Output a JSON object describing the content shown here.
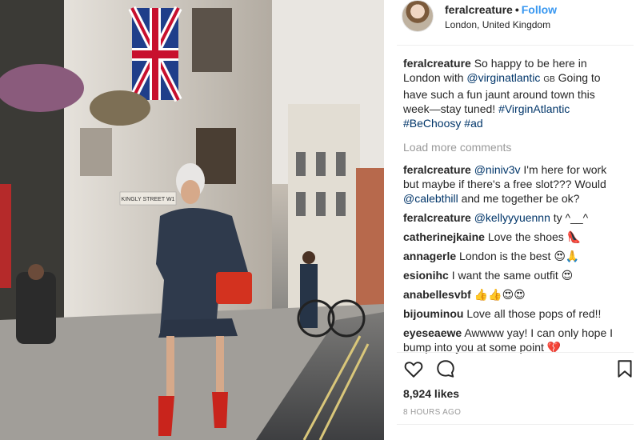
{
  "header": {
    "username": "feralcreature",
    "dot": "•",
    "follow_label": "Follow",
    "location": "London, United Kingdom"
  },
  "caption": {
    "username": "feralcreature",
    "text_1": "So happy to be here in London with",
    "mention": "@virginatlantic",
    "flag": "GB",
    "text_2": "Going to have such a fun jaunt around town this week—stay tuned!",
    "hashtag_1": "#VirginAtlantic",
    "hashtag_2": "#BeChoosy",
    "hashtag_3": "#ad"
  },
  "load_more_label": "Load more comments",
  "comments": [
    {
      "user": "feralcreature",
      "mention": "@niniv3v",
      "text": "I'm here for work but maybe if there's a free slot??? Would",
      "mention2": "@calebthill",
      "text2": "and me together be ok?"
    },
    {
      "user": "feralcreature",
      "mention": "@kellyyyuennn",
      "text": "ty ^__^"
    },
    {
      "user": "catherinejkaine",
      "text": "Love the shoes 👠"
    },
    {
      "user": "annagerle",
      "text": "London is the best 😍🙏"
    },
    {
      "user": "esionihc",
      "text": "I want the same outfit 😍"
    },
    {
      "user": "anabellesvbf",
      "text": "👍👍😍😍"
    },
    {
      "user": "bijouminou",
      "text": "Love all those pops of red!!"
    },
    {
      "user": "eyeseaewe",
      "text": "Awwww yay! I can only hope I bump into you at some point 💔"
    }
  ],
  "likes_label": "8,924 likes",
  "time_label": "8 HOURS AGO",
  "photo": {
    "street_sign": "KINGLY STREET W1"
  },
  "colors": {
    "link": "#003569",
    "follow": "#3897f0",
    "muted": "#999999",
    "text": "#262626"
  },
  "icons": [
    "heart-icon",
    "comment-icon",
    "bookmark-icon"
  ]
}
